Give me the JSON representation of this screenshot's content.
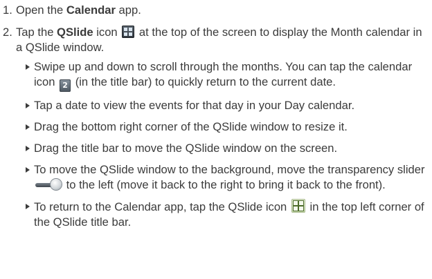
{
  "steps": [
    {
      "number": "1.",
      "text_before": "Open the ",
      "bold": "Calendar",
      "text_after": " app."
    },
    {
      "number": "2.",
      "text_before": "Tap the ",
      "bold": "QSlide",
      "text_mid": " icon",
      "icon": "qslide-icon",
      "text_after": " at the top of the screen to display the Month calendar in a QSlide window."
    }
  ],
  "bullets": [
    {
      "part1": "Swipe up and down to scroll through the months. You can tap the calendar icon",
      "icon": "calendar-icon",
      "icon_label": "2",
      "part2": "(in the title bar) to quickly return to the current date."
    },
    {
      "part1": "Tap a date to view the events for that day in your Day calendar."
    },
    {
      "part1": "Drag the bottom right corner of the QSlide window to resize it."
    },
    {
      "part1": "Drag the title bar to move the QSlide window on the screen."
    },
    {
      "part1": "To move the QSlide window to the background, move the transparency slider",
      "icon": "transparency-slider-icon",
      "part2": "to the left (move it back to the right to bring it back to the front)."
    },
    {
      "part1": "To return to the Calendar app, tap the QSlide icon",
      "icon": "qslide-icon",
      "part2": "in the top left corner of the QSlide title bar."
    }
  ]
}
